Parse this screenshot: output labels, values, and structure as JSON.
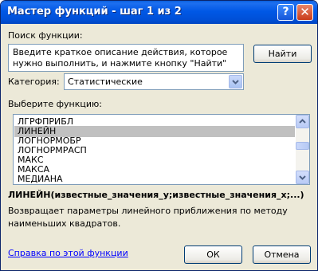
{
  "window": {
    "title": "Мастер функций - шаг 1 из 2",
    "help_glyph": "?",
    "close_glyph": "✕"
  },
  "search": {
    "label": "Поиск функции:",
    "text": "Введите краткое описание действия, которое нужно выполнить, и нажмите кнопку \"Найти\"",
    "find_button": "Найти"
  },
  "category": {
    "label": "Категория:",
    "selected": "Статистические"
  },
  "functions": {
    "label": "Выберите функцию:",
    "items": [
      "ЛГРФПРИБЛ",
      "ЛИНЕЙН",
      "ЛОГНОРМОБР",
      "ЛОГНОРМРАСП",
      "МАКС",
      "МАКСА",
      "МЕДИАНА"
    ],
    "selected_index": 1
  },
  "details": {
    "signature": "ЛИНЕЙН(известные_значения_y;известные_значения_x;...)",
    "description": "Возвращает параметры линейного приближения по методу наименьших квадратов."
  },
  "footer": {
    "help_link": "Справка по этой функции",
    "ok": "ОК",
    "cancel": "Отмена"
  }
}
